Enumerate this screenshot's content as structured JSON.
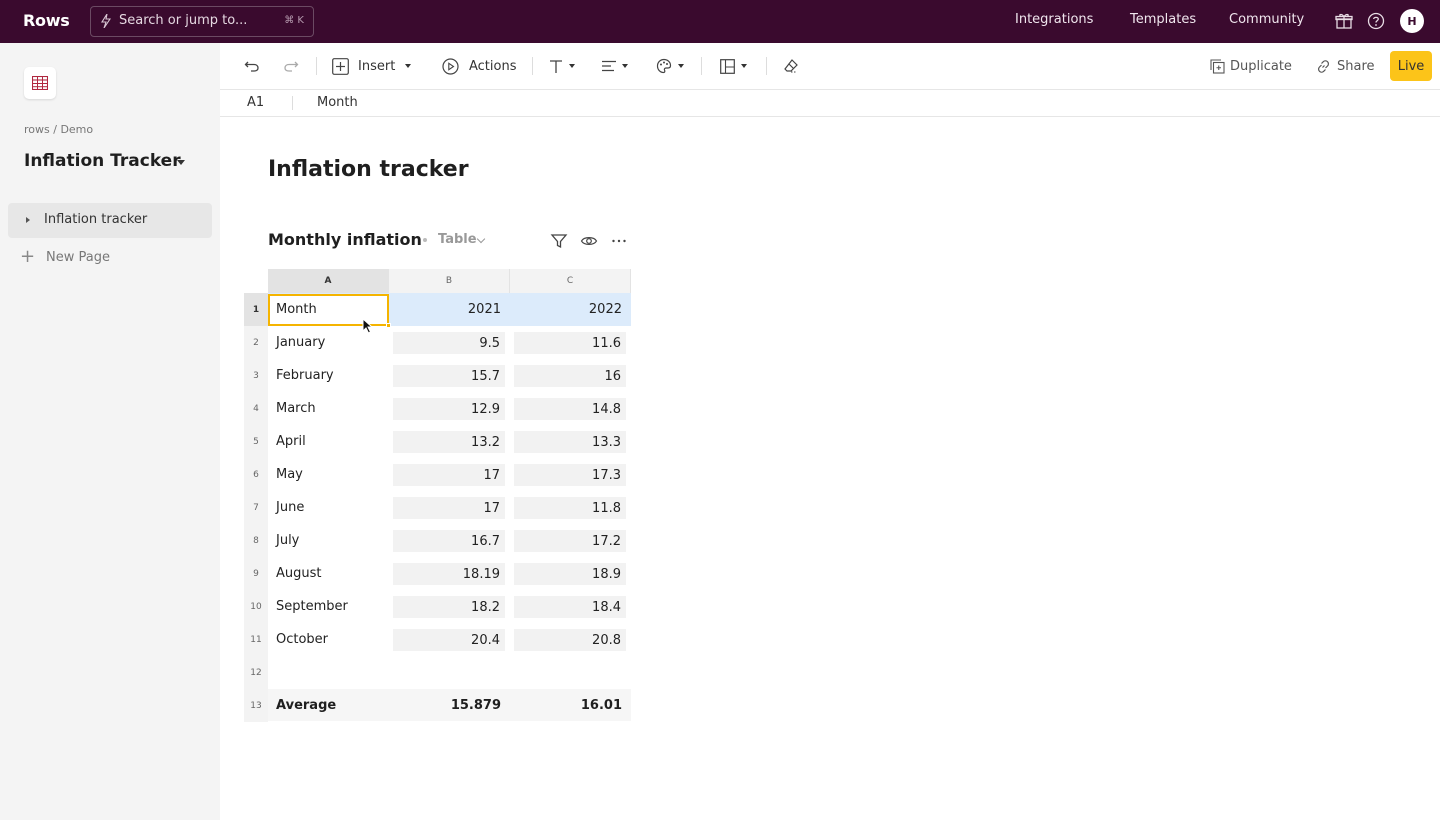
{
  "app": {
    "logo": "Rows"
  },
  "search": {
    "placeholder": "Search or jump to...",
    "shortcut": "⌘ K"
  },
  "topnav": {
    "integrations": "Integrations",
    "templates": "Templates",
    "community": "Community",
    "avatar_initial": "H",
    "bg": "#3a0a2e"
  },
  "toolbar": {
    "insert": "Insert",
    "actions": "Actions",
    "duplicate": "Duplicate",
    "share": "Share",
    "live": "Live",
    "live_color": "#fcc419"
  },
  "formula_bar": {
    "cell_ref": "A1",
    "value": "Month"
  },
  "sidebar": {
    "breadcrumb": "rows / Demo",
    "workspace_title": "Inflation Tracker",
    "pages": [
      {
        "label": "Inflation tracker"
      }
    ],
    "new_page": "New Page"
  },
  "page": {
    "title": "Inflation tracker"
  },
  "table": {
    "title": "Monthly inflation",
    "view": "Table",
    "columns": [
      "A",
      "B",
      "C"
    ],
    "header": [
      "Month",
      "2021",
      "2022"
    ],
    "rows": [
      [
        "January",
        "9.5",
        "11.6"
      ],
      [
        "February",
        "15.7",
        "16"
      ],
      [
        "March",
        "12.9",
        "14.8"
      ],
      [
        "April",
        "13.2",
        "13.3"
      ],
      [
        "May",
        "17",
        "17.3"
      ],
      [
        "June",
        "17",
        "11.8"
      ],
      [
        "July",
        "16.7",
        "17.2"
      ],
      [
        "August",
        "18.19",
        "18.9"
      ],
      [
        "September",
        "18.2",
        "18.4"
      ],
      [
        "October",
        "20.4",
        "20.8"
      ]
    ],
    "row_numbers": [
      "1",
      "2",
      "3",
      "4",
      "5",
      "6",
      "7",
      "8",
      "9",
      "10",
      "11",
      "12",
      "13"
    ],
    "average": {
      "label": "Average",
      "b": "15.879",
      "c": "16.01"
    },
    "selection_color": "#f5b400"
  }
}
